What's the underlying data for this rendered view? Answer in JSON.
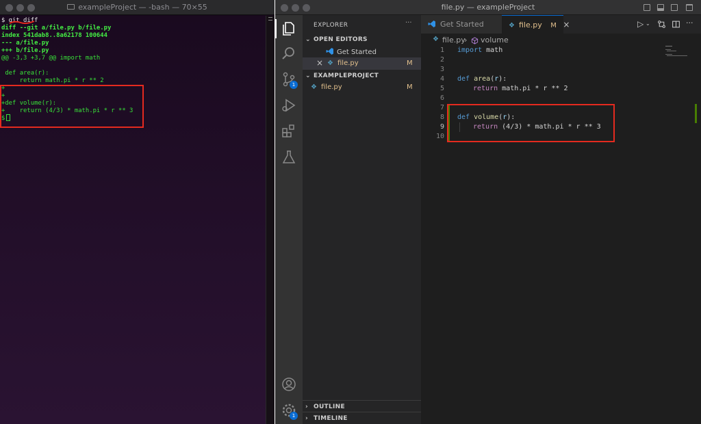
{
  "terminal": {
    "window_title": "exampleProject — -bash — 70×55",
    "lines": [
      {
        "text": "$ git diff",
        "cls": "tl w"
      },
      {
        "text": "diff --git a/file.py b/file.py",
        "cls": "tl b"
      },
      {
        "text": "index 541dab8..8a62178 100644",
        "cls": "tl b"
      },
      {
        "text": "--- a/file.py",
        "cls": "tl b"
      },
      {
        "text": "+++ b/file.py",
        "cls": "tl b"
      },
      {
        "text": "@@ -3,3 +3,7 @@ import math",
        "cls": "tl"
      },
      {
        "text": "",
        "cls": "tl"
      },
      {
        "text": " def area(r):",
        "cls": "tl"
      },
      {
        "text": "     return math.pi * r ** 2",
        "cls": "tl"
      },
      {
        "text": "+",
        "cls": "tl"
      },
      {
        "text": "+",
        "cls": "tl"
      },
      {
        "text": "+def volume(r):",
        "cls": "tl"
      },
      {
        "text": "+    return (4/3) * math.pi * r ** 3",
        "cls": "tl"
      }
    ],
    "prompt": "$"
  },
  "vscode": {
    "window_title": "file.py — exampleProject",
    "sidebar": {
      "title": "EXPLORER",
      "open_editors_label": "OPEN EDITORS",
      "open_editors": [
        {
          "name": "Get Started",
          "status": ""
        },
        {
          "name": "file.py",
          "status": "M"
        }
      ],
      "project_label": "EXAMPLEPROJECT",
      "project_files": [
        {
          "name": "file.py",
          "status": "M"
        }
      ],
      "outline_label": "OUTLINE",
      "timeline_label": "TIMELINE"
    },
    "badges": {
      "source_control": "1",
      "settings": "1"
    },
    "tabs": [
      {
        "label": "Get Started",
        "status": ""
      },
      {
        "label": "file.py",
        "status": "M"
      }
    ],
    "breadcrumb": {
      "file": "file.py",
      "symbol": "volume"
    },
    "line_numbers": [
      "1",
      "2",
      "3",
      "4",
      "5",
      "6",
      "7",
      "8",
      "9",
      "10"
    ],
    "code": {
      "line1": {
        "kw": "import",
        "rest": " math"
      },
      "line4": {
        "kw": "def",
        "fn": "area",
        "arg": "r"
      },
      "line5": {
        "kw": "return",
        "rest": "math.pi * r ** 2"
      },
      "line8": {
        "kw": "def",
        "fn": "volume",
        "arg": "r"
      },
      "line9": {
        "kw": "return",
        "rest": "(4/3) * math.pi * r ** 3"
      }
    }
  },
  "colors": {
    "annotation_red": "#e52a1f",
    "terminal_green": "#39e239",
    "accent_blue": "#0a6cd2"
  }
}
